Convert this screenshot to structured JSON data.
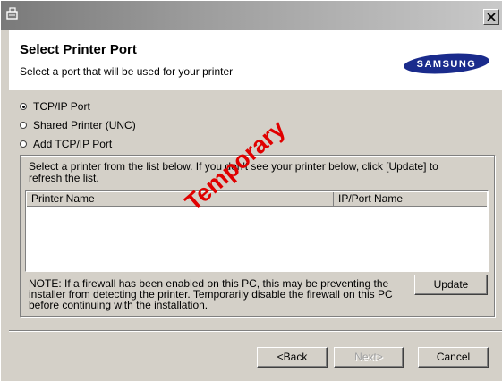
{
  "title_bar": {
    "app_icon": "installer-icon",
    "close_icon": "close-icon"
  },
  "header": {
    "title": "Select Printer Port",
    "subtitle": "Select a port that will be used for your printer",
    "logo_text": "SAMSUNG"
  },
  "port_options": [
    {
      "label": "TCP/IP Port",
      "checked": true
    },
    {
      "label": "Shared Printer (UNC)",
      "checked": false
    },
    {
      "label": "Add TCP/IP Port",
      "checked": false
    }
  ],
  "printer_list": {
    "instruction": "Select a printer from the list below. If you don't see your printer below, click [Update] to refresh the list.",
    "columns": [
      "Printer Name",
      "IP/Port Name"
    ],
    "rows": []
  },
  "note": "NOTE: If a firewall has been enabled on this PC, this may be preventing the installer from detecting the printer. Temporarily disable the firewall on this PC before continuing with the installation.",
  "buttons": {
    "update": "Update",
    "back": "<Back",
    "next": "Next>",
    "cancel": "Cancel"
  },
  "watermark": "Temporary",
  "colors": {
    "dialog_bg": "#d4d0c8",
    "watermark": "#e00000",
    "logo_blue": "#1a2b8c"
  }
}
